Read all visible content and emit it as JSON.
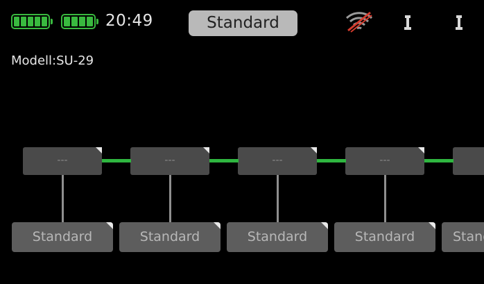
{
  "status_bar": {
    "battery_icons": [
      "battery-full-icon",
      "battery-full-icon"
    ],
    "battery_color": "#39b93f",
    "time": "20:49",
    "mode_button_label": "Standard",
    "signal_icon": "wifi-signal-crossed-icon",
    "bind_icons": [
      "antenna-icon",
      "antenna-icon"
    ]
  },
  "model": {
    "label": "Modell:SU-29"
  },
  "flow": {
    "link_color": "#2fb640",
    "top_boxes": [
      {
        "label": "---"
      },
      {
        "label": "---"
      },
      {
        "label": "---"
      },
      {
        "label": "---"
      },
      {
        "label": "---"
      }
    ],
    "bottom_boxes": [
      {
        "label": "Standard"
      },
      {
        "label": "Standard"
      },
      {
        "label": "Standard"
      },
      {
        "label": "Standard"
      },
      {
        "label": "Standard"
      }
    ]
  }
}
